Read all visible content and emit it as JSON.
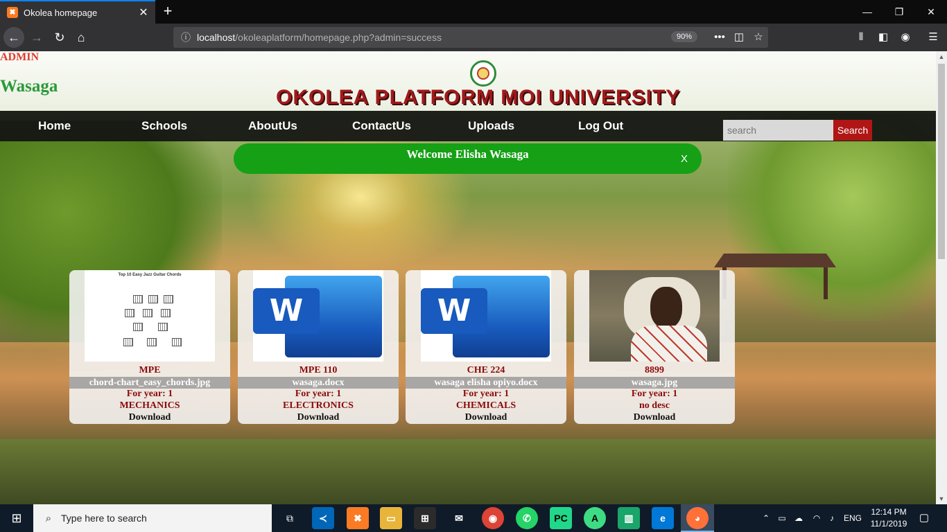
{
  "browser": {
    "tab_title": "Okolea homepage",
    "tab_close": "✕",
    "new_tab": "+",
    "url_host": "localhost",
    "url_path": "/okoleaplatform/homepage.php?admin=success",
    "zoom": "90%",
    "window_controls": [
      "—",
      "❐",
      "✕"
    ]
  },
  "page": {
    "admin_label": "ADMIN",
    "user_label": "Wasaga",
    "site_title": "OKOLEA PLATFORM MOI UNIVERSITY",
    "nav": [
      {
        "label": "Home"
      },
      {
        "label": "Schools"
      },
      {
        "label": "AboutUs"
      },
      {
        "label": "ContactUs"
      },
      {
        "label": "Uploads"
      },
      {
        "label": "Log Out"
      }
    ],
    "search": {
      "placeholder": "search",
      "button": "Search"
    },
    "welcome": {
      "text": "Welcome Elisha Wasaga",
      "close": "X"
    },
    "cards": [
      {
        "code": "MPE",
        "file": "chord-chart_easy_chords.jpg",
        "year": "For year: 1",
        "school": "MECHANICS",
        "download": "Download",
        "thumb": "image",
        "thumb_title": "Top 10 Easy Jazz Guitar Chords"
      },
      {
        "code": "MPE 110",
        "file": "wasaga.docx",
        "year": "For year: 1",
        "school": "ELECTRONICS",
        "download": "Download",
        "thumb": "word-icon",
        "thumb_letter": "W"
      },
      {
        "code": "CHE 224",
        "file": "wasaga elisha opiyo.docx",
        "year": "For year: 1",
        "school": "CHEMICALS",
        "download": "Download",
        "thumb": "word-icon",
        "thumb_letter": "W"
      },
      {
        "code": "8899",
        "file": "wasaga.jpg",
        "year": "For year: 1",
        "school": "no desc",
        "download": "Download",
        "thumb": "photo"
      }
    ]
  },
  "taskbar": {
    "search_placeholder": "Type here to search",
    "language": "ENG",
    "time": "12:14 PM",
    "date": "11/1/2019"
  },
  "colors": {
    "accent_red": "#a11a1a",
    "user_green": "#2b9a3a",
    "welcome_green": "#15a015",
    "search_button": "#b01616",
    "menu_bg": "#121212"
  }
}
